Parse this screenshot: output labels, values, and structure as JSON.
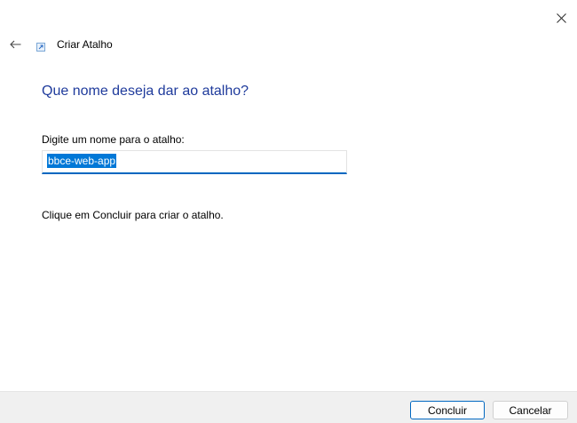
{
  "window": {
    "title": "Criar Atalho",
    "close_icon": "close-icon",
    "back_icon": "arrow-left-icon",
    "app_icon": "shortcut-icon"
  },
  "main": {
    "heading": "Que nome deseja dar ao atalho?",
    "name_label": "Digite um nome para o atalho:",
    "name_value": "bbce-web-app",
    "hint": "Clique em Concluir para criar o atalho."
  },
  "footer": {
    "finish_label": "Concluir",
    "cancel_label": "Cancelar"
  },
  "colors": {
    "heading": "#1f3b9c",
    "accent": "#0067c0",
    "selection": "#0078d7",
    "footer_bg": "#f0f0f0"
  }
}
